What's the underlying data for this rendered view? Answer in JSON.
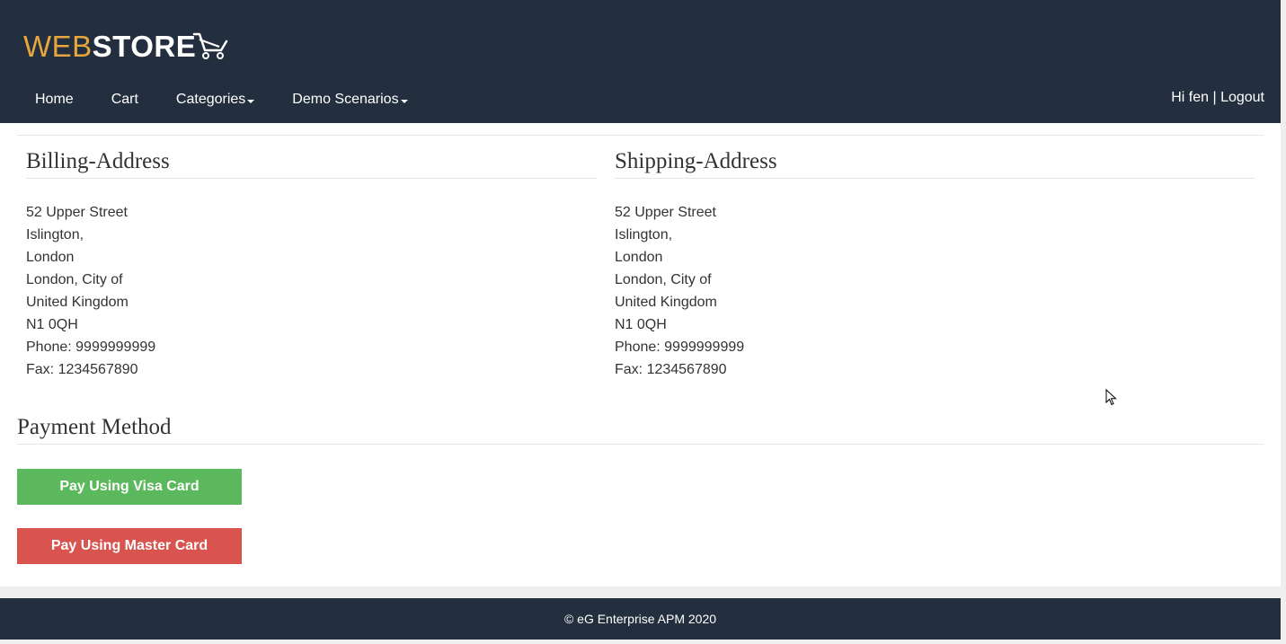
{
  "brand": {
    "part1": "WEB",
    "part2": "STORE"
  },
  "nav": {
    "items": [
      {
        "label": "Home",
        "dropdown": false
      },
      {
        "label": "Cart",
        "dropdown": false
      },
      {
        "label": "Categories",
        "dropdown": true
      },
      {
        "label": "Demo Scenarios",
        "dropdown": true
      }
    ],
    "user_greeting": "Hi fen",
    "separator": "|",
    "logout_label": "Logout"
  },
  "billing": {
    "title": "Billing-Address",
    "lines": [
      "52 Upper Street",
      "Islington,",
      "London",
      "London, City of",
      "United Kingdom",
      "N1 0QH",
      "Phone: 9999999999",
      "Fax: 1234567890"
    ]
  },
  "shipping": {
    "title": "Shipping-Address",
    "lines": [
      "52 Upper Street",
      "Islington,",
      "London",
      "London, City of",
      "United Kingdom",
      "N1 0QH",
      "Phone: 9999999999",
      "Fax: 1234567890"
    ]
  },
  "payment": {
    "title": "Payment Method",
    "visa_label": "Pay Using Visa Card",
    "master_label": "Pay Using Master Card"
  },
  "footer": {
    "text": "© eG Enterprise APM 2020"
  },
  "colors": {
    "navbar_bg": "#232f3e",
    "brand_accent": "#e6a63d",
    "visa_button": "#5cb85c",
    "master_button": "#d9534f"
  }
}
